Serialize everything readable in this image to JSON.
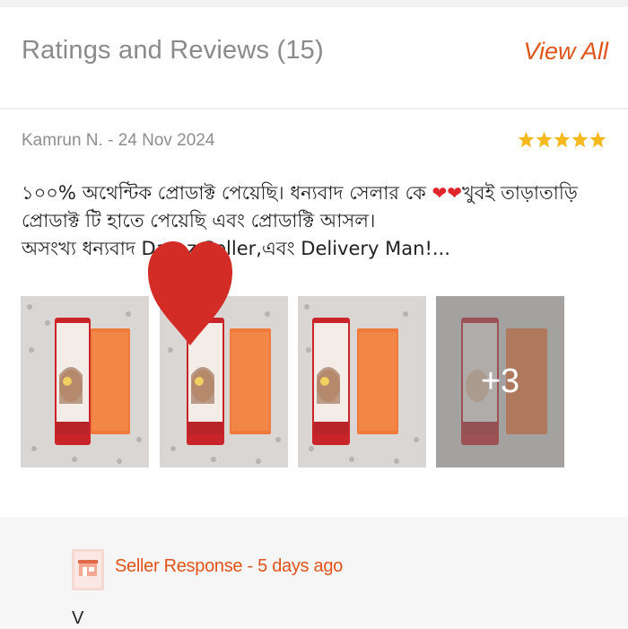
{
  "header": {
    "title": "Ratings and Reviews (15)",
    "view_all_label": "View All"
  },
  "review": {
    "author_date": "Kamrun N. - 24 Nov 2024",
    "rating": 5,
    "line1": "১০০% অথেন্টিক প্রোডাক্ট পেয়েছি। ধন্যবাদ সেলার কে ",
    "line1_end": "খুবই তাড়াতাড়ি",
    "line2": "প্রোডাক্ট টি হাতে পেয়েছি এবং প্রোডাক্টি আসল।",
    "line3": "অসংখ্য ধন্যবাদ Daraz Seller,এবং Delivery Man!...",
    "images_more": "+3"
  },
  "seller_response": {
    "label": "Seller Response - 5 days ago",
    "text": "V"
  },
  "colors": {
    "accent": "#e0531a",
    "star": "#f5b81e",
    "heart": "#e0262b"
  }
}
